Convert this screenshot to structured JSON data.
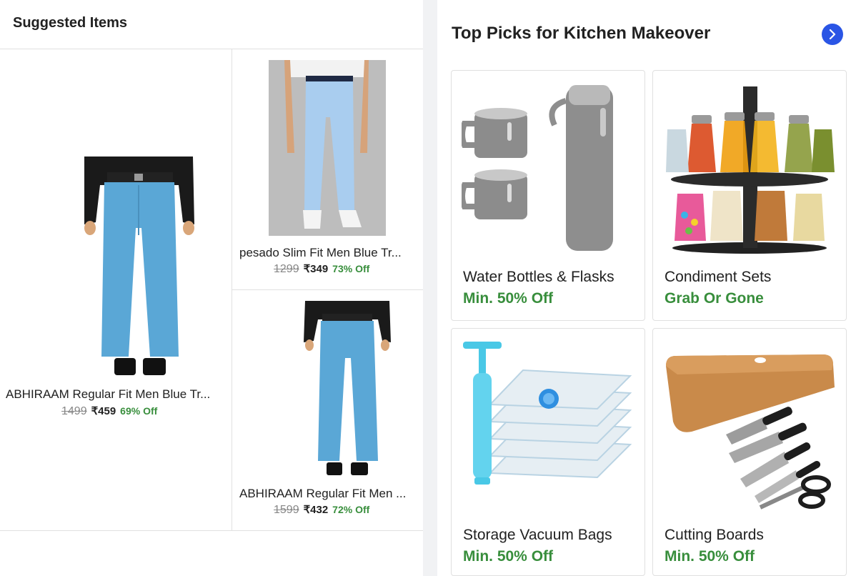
{
  "suggested": {
    "title": "Suggested Items",
    "items": [
      {
        "name": "ABHIRAAM Regular Fit Men Blue Tr...",
        "mrp": "1499",
        "price": "₹459",
        "discount": "69% Off"
      },
      {
        "name": "pesado Slim Fit Men Blue Tr...",
        "mrp": "1299",
        "price": "₹349",
        "discount": "73% Off"
      },
      {
        "name": "ABHIRAAM Regular Fit Men ...",
        "mrp": "1599",
        "price": "₹432",
        "discount": "72% Off"
      }
    ]
  },
  "top_picks": {
    "title": "Top Picks for Kitchen Makeover",
    "next_icon": "chevron-right-icon",
    "cards": [
      {
        "label": "Water Bottles & Flasks",
        "offer": "Min. 50% Off",
        "image": "flask-set-image"
      },
      {
        "label": "Condiment Sets",
        "offer": "Grab Or Gone",
        "image": "spice-rack-image"
      },
      {
        "label": "Storage Vacuum Bags",
        "offer": "Min. 50% Off",
        "image": "vacuum-bags-image"
      },
      {
        "label": "Cutting Boards",
        "offer": "Min. 50% Off",
        "image": "cutting-board-image"
      }
    ]
  },
  "colors": {
    "discount_green": "#388e3c",
    "accent_blue": "#2a55e5",
    "page_bg": "#f1f2f4"
  }
}
